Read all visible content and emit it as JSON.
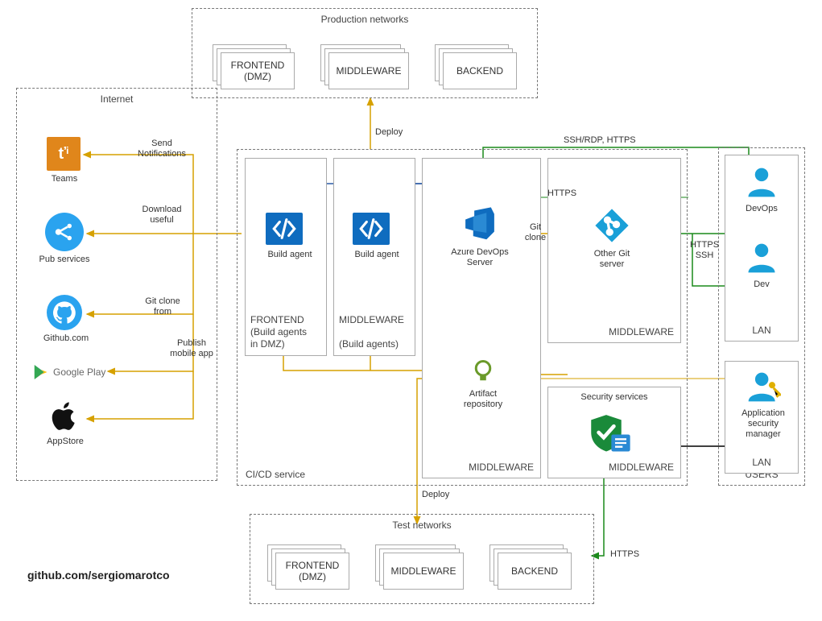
{
  "meta": {
    "source_hint": "github.com/sergiomarotco"
  },
  "zones": {
    "production": {
      "title": "Production networks",
      "blocks": [
        "FRONTEND\n(DMZ)",
        "MIDDLEWARE",
        "BACKEND"
      ]
    },
    "internet": {
      "title": "Internet",
      "items": {
        "teams": "Teams",
        "pub_services": "Pub services",
        "github": "Github.com",
        "googleplay": "Google Play",
        "appstore": "AppStore"
      }
    },
    "cicd": {
      "title": "CI/CD service",
      "frontend_col": {
        "zone": "FRONTEND\n(Build agents\nin DMZ)",
        "node": "Build agent"
      },
      "middleware_col1": {
        "zone": "MIDDLEWARE\n\n(Build agents)",
        "node": "Build agent"
      },
      "middleware_col2": {
        "zone": "MIDDLEWARE",
        "ado": "Azure DevOps\nServer",
        "artifact": "Artifact\nrepository"
      },
      "middleware_col3": {
        "zone": "MIDDLEWARE",
        "other_git": "Other Git\nserver",
        "security": "Security services",
        "zone2": "MIDDLEWARE"
      },
      "deploy_label": "Deploy"
    },
    "test": {
      "title": "Test networks",
      "blocks": [
        "FRONTEND\n(DMZ)",
        "MIDDLEWARE",
        "BACKEND"
      ]
    },
    "users": {
      "title": "USERS",
      "devops": "DevOps",
      "dev": "Dev",
      "appsec": "Application\nsecurity\nmanager",
      "lan": "LAN"
    }
  },
  "edges": {
    "send_notifications": "Send\nNotifications",
    "download_useful": "Download\nuseful",
    "git_clone_from": "Git clone\nfrom",
    "publish_mobile": "Publish\nmobile app",
    "deploy": "Deploy",
    "ssh_rdp_https": "SSH/RDP, HTTPS",
    "https": "HTTPS",
    "git_clone": "Git\nclone",
    "https_ssh": "HTTPS\nSSH"
  },
  "icons": {
    "build_agent": "code-icon",
    "ado": "azure-devops-icon",
    "git": "git-icon",
    "teams": "teams-icon",
    "github": "github-icon",
    "pub": "pubsub-icon",
    "googleplay": "googleplay-icon",
    "apple": "apple-icon",
    "user": "user-icon",
    "user_key": "user-key-icon",
    "shield": "shield-check-icon",
    "artifact": "artifact-ring-icon"
  }
}
